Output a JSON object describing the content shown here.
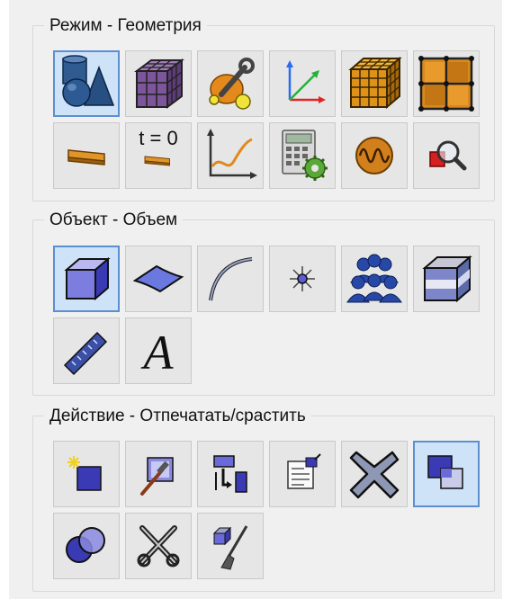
{
  "groups": {
    "mode": {
      "title": "Режим - Геометрия"
    },
    "object": {
      "title": "Объект - Объем"
    },
    "action": {
      "title": "Действие - Отпечатать/срастить"
    }
  },
  "buttons": {
    "t0_label": "t = 0",
    "text_tool_glyph": "A"
  },
  "icons": {
    "mode": [
      "geometry-shapes-icon",
      "mesh-cube-icon",
      "tools-wrench-icon",
      "axes-icon",
      "structured-mesh-icon",
      "grid-icon",
      "thin-surface-icon",
      "t0-surface-icon",
      "graph-plot-icon",
      "calculator-gear-icon",
      "wave-signal-icon",
      "zoom-magnifier-icon"
    ],
    "object": [
      "volume-cube-icon",
      "face-surface-icon",
      "edge-curve-icon",
      "vertex-star-icon",
      "group-people-icon",
      "layered-cube-icon",
      "ruler-icon",
      "text-a-icon"
    ],
    "action": [
      "new-cube-sparkle-icon",
      "hammer-image-icon",
      "transfer-arrows-icon",
      "document-properties-icon",
      "big-x-delete-icon",
      "overlap-squares-icon",
      "circles-unite-icon",
      "scissors-icon",
      "cube-brush-icon"
    ]
  },
  "colors": {
    "panel_bg": "#f0f0f0",
    "active_border": "#5b8fd0",
    "active_bg": "#cfe3f8",
    "button_bg": "#e6e6e6"
  }
}
